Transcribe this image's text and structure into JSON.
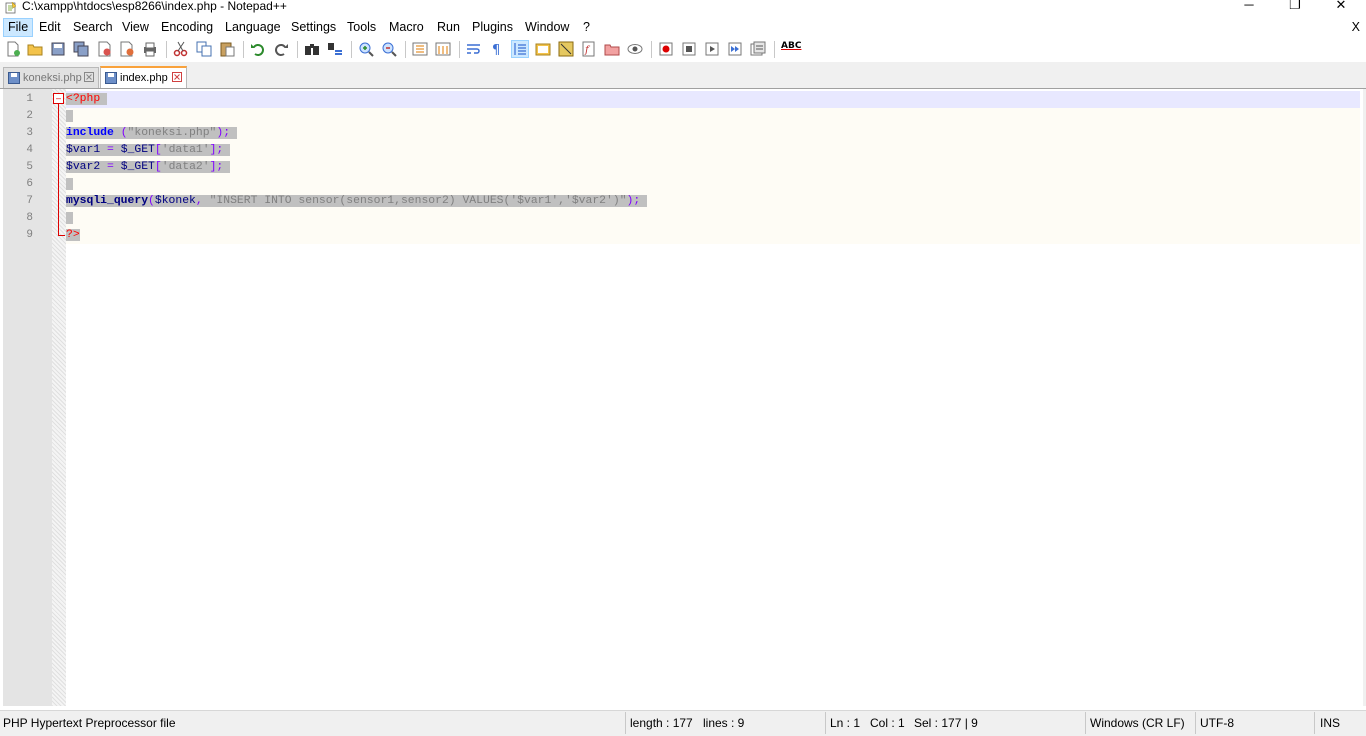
{
  "window": {
    "title": "C:\\xampp\\htdocs\\esp8266\\index.php - Notepad++",
    "controls": {
      "minimize": "─",
      "restore": "❐",
      "close": "✕"
    }
  },
  "menubar": {
    "items": [
      "File",
      "Edit",
      "Search",
      "View",
      "Encoding",
      "Language",
      "Settings",
      "Tools",
      "Macro",
      "Run",
      "Plugins",
      "Window",
      "?"
    ],
    "active": "File",
    "close_doc": "X"
  },
  "toolbar": {
    "icons": [
      "new-file-icon",
      "open-file-icon",
      "save-icon",
      "save-all-icon",
      "close-icon",
      "close-all-icon",
      "print-icon",
      "cut-icon",
      "copy-icon",
      "paste-icon",
      "undo-icon",
      "redo-icon",
      "find-icon",
      "replace-icon",
      "zoom-in-icon",
      "zoom-out-icon",
      "sync-vertical-icon",
      "sync-horizontal-icon",
      "word-wrap-icon",
      "show-all-chars-icon",
      "indent-guide-icon",
      "user-defined-lang-icon",
      "doc-map-icon",
      "function-list-icon",
      "folder-as-workspace-icon",
      "monitoring-icon",
      "record-macro-icon",
      "stop-record-icon",
      "play-macro-icon",
      "run-macro-multiple-icon",
      "save-macro-icon",
      "spell-check-icon"
    ],
    "spell_label": "ABC"
  },
  "tabs": [
    {
      "label": "koneksi.php",
      "active": false
    },
    {
      "label": "index.php",
      "active": true
    }
  ],
  "editor": {
    "lines": [
      {
        "num": "1",
        "tokens": [
          {
            "t": "<?php",
            "c": "php"
          }
        ]
      },
      {
        "num": "2",
        "tokens": []
      },
      {
        "num": "3",
        "tokens": [
          {
            "t": "include",
            "c": "kw"
          },
          {
            "t": " (",
            "c": "op"
          },
          {
            "t": "\"koneksi.php\"",
            "c": "str"
          },
          {
            "t": ");",
            "c": "op"
          }
        ]
      },
      {
        "num": "4",
        "tokens": [
          {
            "t": "$var1",
            "c": "var"
          },
          {
            "t": " = ",
            "c": "op"
          },
          {
            "t": "$_GET",
            "c": "var"
          },
          {
            "t": "[",
            "c": "op"
          },
          {
            "t": "'data1'",
            "c": "str"
          },
          {
            "t": "];",
            "c": "op"
          }
        ]
      },
      {
        "num": "5",
        "tokens": [
          {
            "t": "$var2",
            "c": "var"
          },
          {
            "t": " = ",
            "c": "op"
          },
          {
            "t": "$_GET",
            "c": "var"
          },
          {
            "t": "[",
            "c": "op"
          },
          {
            "t": "'data2'",
            "c": "str"
          },
          {
            "t": "];",
            "c": "op"
          }
        ]
      },
      {
        "num": "6",
        "tokens": []
      },
      {
        "num": "7",
        "tokens": [
          {
            "t": "mysqli_query",
            "c": "fn"
          },
          {
            "t": "(",
            "c": "op"
          },
          {
            "t": "$konek",
            "c": "var"
          },
          {
            "t": ", ",
            "c": "op"
          },
          {
            "t": "\"INSERT INTO sensor(sensor1,sensor2) VALUES('$var1','$var2')\"",
            "c": "str"
          },
          {
            "t": ");",
            "c": "op"
          }
        ]
      },
      {
        "num": "8",
        "tokens": []
      },
      {
        "num": "9",
        "tokens": [
          {
            "t": "?>",
            "c": "php"
          }
        ]
      }
    ],
    "fold_marker": "⊟"
  },
  "statusbar": {
    "filetype": "PHP Hypertext Preprocessor file",
    "length": "length : 177",
    "lines": "lines : 9",
    "ln": "Ln : 1",
    "col": "Col : 1",
    "sel": "Sel : 177 | 9",
    "eol": "Windows (CR LF)",
    "encoding": "UTF-8",
    "mode": "INS"
  },
  "colors": {
    "accent_tab": "#f9a23c",
    "current_line": "#e8e8ff",
    "selection": "#c0c0c0",
    "keyword": "#0000ff",
    "php_tag": "#ff0000"
  }
}
